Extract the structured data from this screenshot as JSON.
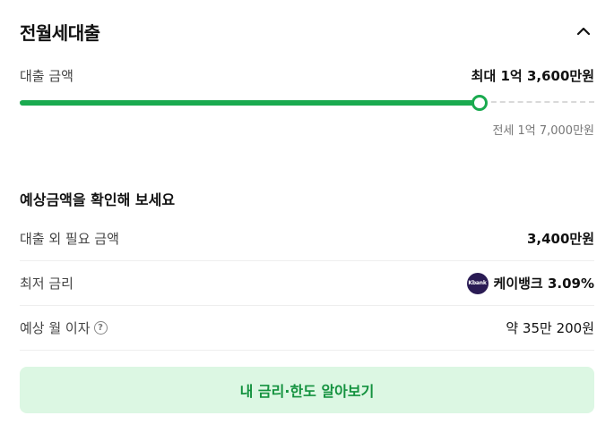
{
  "header": {
    "title": "전월세대출",
    "collapse_icon": "chevron-up-icon"
  },
  "loan_amount": {
    "label": "대출 금액",
    "value": "최대 1억 3,600만원",
    "slider_fraction": 0.8,
    "max_note": "전세 1억 7,000만원",
    "accent_color": "#1aaa4f"
  },
  "estimate": {
    "title": "예상금액을 확인해 보세요",
    "rows": [
      {
        "label": "대출 외 필요 금액",
        "value": "3,400만원"
      },
      {
        "label": "최저 금리",
        "value": "케이뱅크 3.09%",
        "logo_text": "Kbank",
        "logo_color": "#2a1b54"
      },
      {
        "label": "예상 월 이자",
        "value": "약 35만 200원",
        "help_icon": "question-circle-icon",
        "help_glyph": "?"
      }
    ]
  },
  "cta": {
    "label": "내 금리·한도 알아보기",
    "background": "#dcf7e3",
    "text_color": "#14923f"
  }
}
